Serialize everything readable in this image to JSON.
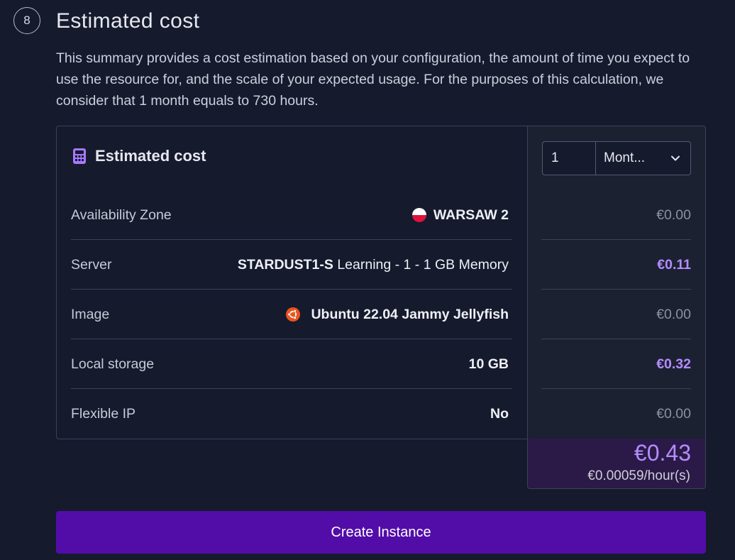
{
  "step": {
    "number": "8",
    "title": "Estimated cost",
    "description": "This summary provides a cost estimation based on your configuration, the amount of time you expect to use the resource for, and the scale of your expected usage. For the purposes of this calculation, we consider that 1 month equals to 730 hours."
  },
  "card": {
    "title": "Estimated cost",
    "icon": "calculator-icon"
  },
  "duration": {
    "quantity": "1",
    "period": "Mont..."
  },
  "rows": [
    {
      "label": "Availability Zone",
      "value": "WARSAW 2",
      "price": "€0.00",
      "icon": "poland-flag-icon"
    },
    {
      "label": "Server",
      "value_bold": "STARDUST1-S",
      "value": " Learning - 1 - 1 GB Memory",
      "price": "€0.11"
    },
    {
      "label": "Image",
      "value": "Ubuntu 22.04 Jammy Jellyfish",
      "price": "€0.00",
      "icon": "ubuntu-icon"
    },
    {
      "label": "Local storage",
      "value": "10 GB",
      "price": "€0.32"
    },
    {
      "label": "Flexible IP",
      "value": "No",
      "price": "€0.00"
    }
  ],
  "total": {
    "amount": "€0.43",
    "hourly": "€0.00059/hour(s)"
  },
  "actions": {
    "create_label": "Create Instance"
  },
  "colors": {
    "background": "#151a2d",
    "accent": "#b48cff",
    "primary_button": "#520da9",
    "total_background": "#2b1a47"
  }
}
